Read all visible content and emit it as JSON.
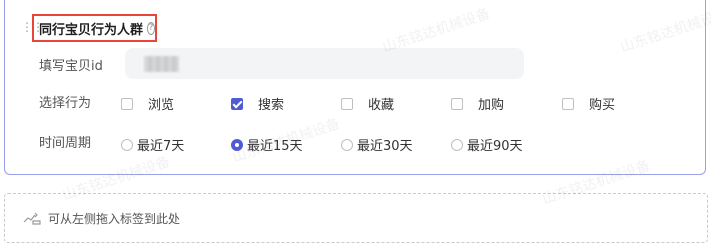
{
  "section": {
    "title": "同行宝贝行为人群",
    "help_icon": "question-circle-icon",
    "drag_icon": "drag-handle-icon"
  },
  "item_id": {
    "label": "填写宝贝id",
    "value_redacted": true
  },
  "behavior": {
    "label": "选择行为",
    "options": [
      {
        "label": "浏览",
        "checked": false
      },
      {
        "label": "搜索",
        "checked": true
      },
      {
        "label": "收藏",
        "checked": false
      },
      {
        "label": "加购",
        "checked": false
      },
      {
        "label": "购买",
        "checked": false
      }
    ]
  },
  "period": {
    "label": "时间周期",
    "options": [
      {
        "label": "最近7天",
        "selected": false
      },
      {
        "label": "最近15天",
        "selected": true
      },
      {
        "label": "最近30天",
        "selected": false
      },
      {
        "label": "最近90天",
        "selected": false
      }
    ]
  },
  "dropzone": {
    "icon": "drag-drop-icon",
    "text": "可从左侧拖入标签到此处"
  },
  "watermark": "山东铭达机械设备",
  "colors": {
    "accent": "#4f5bd5",
    "highlight_border": "#e8453c",
    "card_border": "#9aa0ea"
  }
}
